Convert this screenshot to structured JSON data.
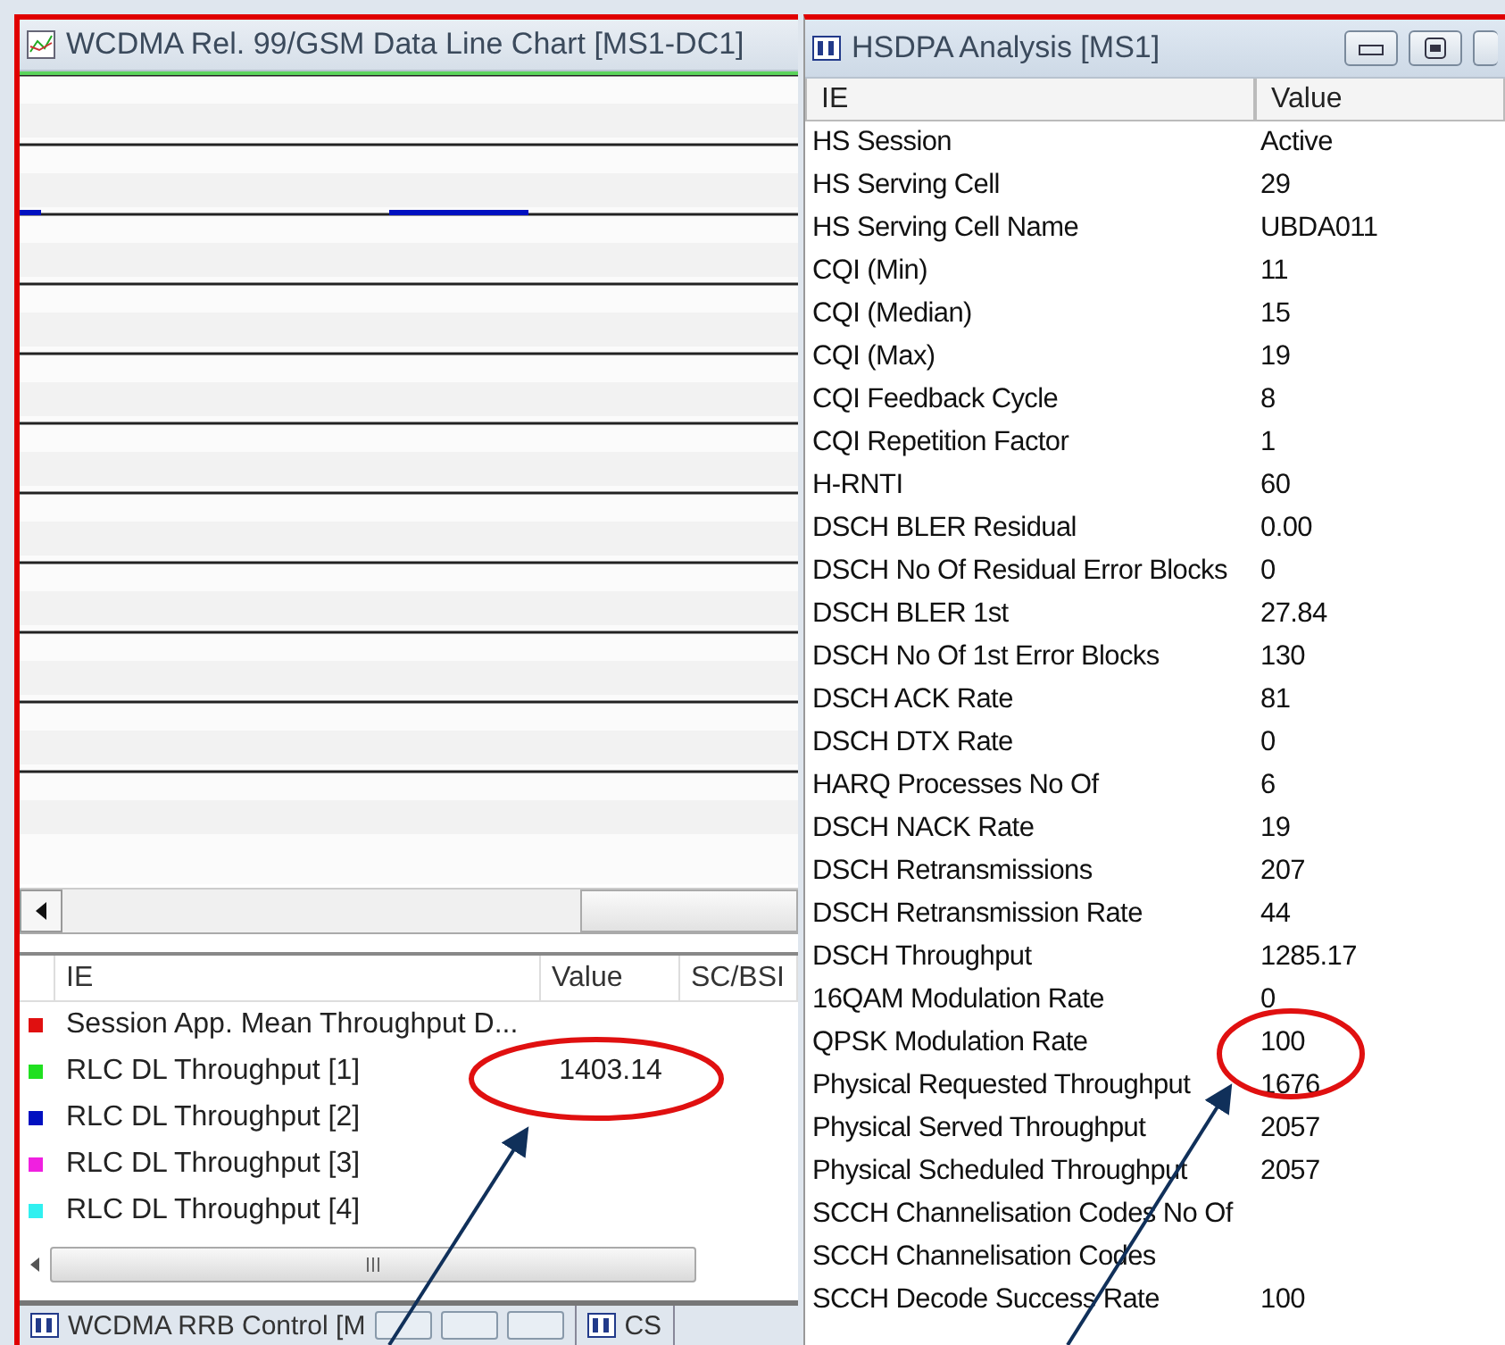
{
  "chart_window": {
    "title": "WCDMA Rel. 99/GSM Data Line Chart [MS1-DC1]",
    "legend": {
      "columns": [
        "IE",
        "Value",
        "SC/BSI"
      ],
      "rows": [
        {
          "ie": "Session App. Mean Throughput D...",
          "color": "#e01010"
        },
        {
          "ie": "RLC DL Throughput [1]",
          "value": "1403.14",
          "color": "#20e020"
        },
        {
          "ie": "RLC DL Throughput [2]",
          "color": "#0010c0"
        },
        {
          "ie": "RLC DL Throughput [3]",
          "color": "#f020e0"
        },
        {
          "ie": "RLC DL Throughput [4]",
          "color": "#30f0f0"
        }
      ]
    }
  },
  "bottom_tabs": [
    {
      "label": "WCDMA RRB Control [M"
    },
    {
      "label": "CS"
    }
  ],
  "hsdpa_window": {
    "title": "HSDPA Analysis [MS1]",
    "columns": [
      "IE",
      "Value"
    ],
    "rows": [
      {
        "ie": "HS Session",
        "value": "Active"
      },
      {
        "ie": "HS Serving Cell",
        "value": "29"
      },
      {
        "ie": "HS Serving Cell Name",
        "value": "UBDA011"
      },
      {
        "ie": "CQI (Min)",
        "value": "11"
      },
      {
        "ie": "CQI (Median)",
        "value": "15"
      },
      {
        "ie": "CQI (Max)",
        "value": "19"
      },
      {
        "ie": "CQI Feedback Cycle",
        "value": "8"
      },
      {
        "ie": "CQI Repetition Factor",
        "value": "1"
      },
      {
        "ie": "H-RNTI",
        "value": "60"
      },
      {
        "ie": "DSCH BLER Residual",
        "value": "0.00"
      },
      {
        "ie": "DSCH No Of Residual Error Blocks",
        "value": "0"
      },
      {
        "ie": "DSCH BLER 1st",
        "value": "27.84"
      },
      {
        "ie": "DSCH No Of 1st Error Blocks",
        "value": "130"
      },
      {
        "ie": "DSCH ACK Rate",
        "value": "81"
      },
      {
        "ie": "DSCH DTX Rate",
        "value": "0"
      },
      {
        "ie": "HARQ Processes No Of",
        "value": "6"
      },
      {
        "ie": "DSCH NACK Rate",
        "value": "19"
      },
      {
        "ie": "DSCH Retransmissions",
        "value": "207"
      },
      {
        "ie": "DSCH Retransmission Rate",
        "value": "44"
      },
      {
        "ie": "DSCH Throughput",
        "value": "1285.17"
      },
      {
        "ie": "16QAM Modulation Rate",
        "value": "0"
      },
      {
        "ie": "QPSK Modulation Rate",
        "value": "100"
      },
      {
        "ie": "Physical Requested Throughput",
        "value": "1676"
      },
      {
        "ie": "Physical Served Throughput",
        "value": "2057"
      },
      {
        "ie": "Physical Scheduled Throughput",
        "value": "2057"
      },
      {
        "ie": "SCCH Channelisation Codes No Of"
      },
      {
        "ie": "SCCH Channelisation Codes"
      },
      {
        "ie": "SCCH Decode Success Rate",
        "value": "100"
      }
    ]
  }
}
